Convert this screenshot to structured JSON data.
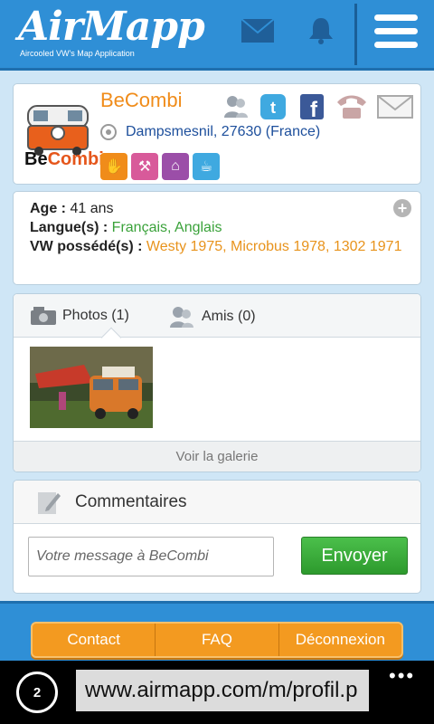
{
  "header": {
    "logo": "AirMapp",
    "tagline": "Aircooled VW's Map Application"
  },
  "profile": {
    "name": "BeCombi",
    "location": "Dampsmesnil, 27630 (France)",
    "brand_prefix": "Be",
    "brand_suffix": "Combi"
  },
  "info": {
    "age_label": "Age :",
    "age_value": "41 ans",
    "lang_label": "Langue(s) :",
    "lang_value": "Français, Anglais",
    "vw_label": "VW possédé(s) :",
    "vw_value": "Westy 1975, Microbus 1978, 1302 1971"
  },
  "media": {
    "tab_photos": "Photos (1)",
    "tab_friends": "Amis (0)",
    "gallery_link": "Voir la galerie"
  },
  "comments": {
    "title": "Commentaires",
    "placeholder": "Votre message à BeCombi",
    "send_label": "Envoyer"
  },
  "footer": {
    "contact": "Contact",
    "faq": "FAQ",
    "logout": "Déconnexion"
  },
  "browser": {
    "url": "www.airmapp.com/m/profil.p",
    "tab_count": "2"
  }
}
